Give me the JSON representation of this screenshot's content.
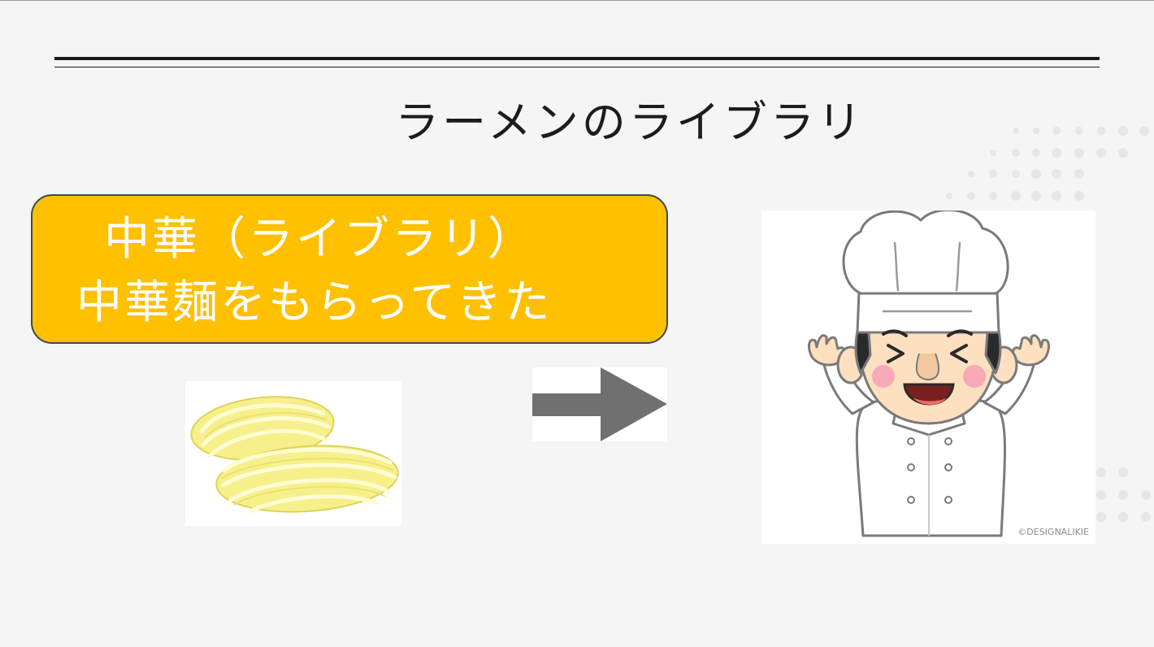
{
  "slide": {
    "title": "ラーメンのライブラリ",
    "callout": {
      "line1": "中華（ライブラリ）",
      "line2": "中華麺をもらってきた"
    },
    "chef_image": {
      "copyright": "©DESIGNALIKIE"
    }
  },
  "colors": {
    "background": "#f5f5f5",
    "callout_fill": "#ffc000",
    "callout_border": "#3b4a5a",
    "arrow": "#707070",
    "noodle": "#f5ec80"
  },
  "icons": {
    "noodles": "noodles-icon",
    "arrow": "arrow-right-icon",
    "chef": "chef-icon"
  }
}
